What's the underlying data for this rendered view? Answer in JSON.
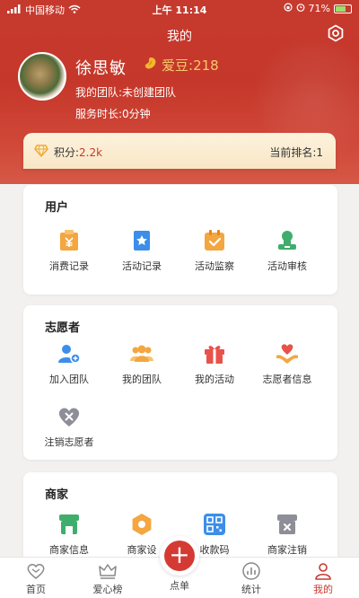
{
  "status_bar": {
    "carrier": "中国移动",
    "time": "上午 11:14",
    "battery": "71%",
    "battery_level": 0.71
  },
  "header": {
    "title": "我的",
    "user_name": "徐思敏",
    "love_bean_label": "爱豆:",
    "love_bean_value": "218",
    "team": "我的团队:未创建团队",
    "service_time": "服务时长:0分钟"
  },
  "points": {
    "label": "积分:",
    "value": "2.2k",
    "rank": "当前排名:1"
  },
  "sections": {
    "user": {
      "title": "用户",
      "items": [
        {
          "label": "消费记录",
          "icon": "consumption-record-icon"
        },
        {
          "label": "活动记录",
          "icon": "activity-record-icon"
        },
        {
          "label": "活动监察",
          "icon": "activity-monitor-icon"
        },
        {
          "label": "活动审核",
          "icon": "activity-review-icon"
        }
      ]
    },
    "volunteer": {
      "title": "志愿者",
      "items": [
        {
          "label": "加入团队",
          "icon": "join-team-icon"
        },
        {
          "label": "我的团队",
          "icon": "my-team-icon"
        },
        {
          "label": "我的活动",
          "icon": "my-activity-icon"
        },
        {
          "label": "志愿者信息",
          "icon": "volunteer-info-icon"
        },
        {
          "label": "注销志愿者",
          "icon": "cancel-volunteer-icon"
        }
      ]
    },
    "merchant": {
      "title": "商家",
      "items": [
        {
          "label": "商家信息",
          "icon": "merchant-info-icon"
        },
        {
          "label": "商家设",
          "icon": "merchant-settings-icon"
        },
        {
          "label": "收款码",
          "icon": "qr-code-icon"
        },
        {
          "label": "商家注销",
          "icon": "merchant-cancel-icon"
        }
      ]
    }
  },
  "tabbar": {
    "items": [
      {
        "label": "首页",
        "icon": "heart-home-icon"
      },
      {
        "label": "爱心榜",
        "icon": "crown-icon"
      },
      {
        "label": "点单",
        "icon": "plus-icon"
      },
      {
        "label": "统计",
        "icon": "chart-icon"
      },
      {
        "label": "我的",
        "icon": "person-icon"
      }
    ]
  },
  "colors": {
    "brand_red": "#c63a2e",
    "gold": "#f7c86a",
    "icon_orange": "#f4a640",
    "icon_blue": "#3c8ee8",
    "icon_green": "#3fae6d",
    "icon_grey": "#8e8e99"
  }
}
